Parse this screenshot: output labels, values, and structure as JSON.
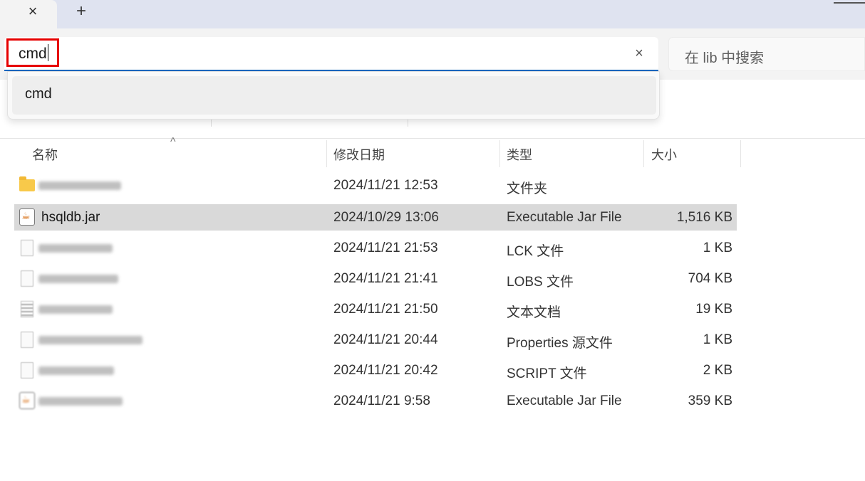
{
  "tabbar": {
    "close_glyph": "×",
    "new_tab_glyph": "+"
  },
  "address": {
    "value": "cmd",
    "clear_glyph": "×"
  },
  "search": {
    "placeholder": "在 lib 中搜索"
  },
  "suggestions": [
    {
      "label": "cmd"
    }
  ],
  "columns": {
    "name": "名称",
    "modified": "修改日期",
    "type": "类型",
    "size": "大小",
    "sort_glyph": "^"
  },
  "files": [
    {
      "icon": "folder-icon",
      "name": "",
      "name_blurred": true,
      "modified": "2024/11/21 12:53",
      "type": "文件夹",
      "size": ""
    },
    {
      "icon": "java-jar-icon",
      "name": "hsqldb.jar",
      "name_blurred": false,
      "modified": "2024/10/29 13:06",
      "type": "Executable Jar File",
      "size": "1,516 KB",
      "selected": true
    },
    {
      "icon": "file-icon",
      "name": "",
      "name_blurred": true,
      "modified": "2024/11/21 21:53",
      "type": "LCK 文件",
      "size": "1 KB"
    },
    {
      "icon": "file-icon",
      "name": "",
      "name_blurred": true,
      "modified": "2024/11/21 21:41",
      "type": "LOBS 文件",
      "size": "704 KB"
    },
    {
      "icon": "text-file-icon",
      "name": "",
      "name_blurred": true,
      "modified": "2024/11/21 21:50",
      "type": "文本文档",
      "size": "19 KB"
    },
    {
      "icon": "file-icon",
      "name": "",
      "name_blurred": true,
      "modified": "2024/11/21 20:44",
      "type": "Properties 源文件",
      "size": "1 KB"
    },
    {
      "icon": "file-icon",
      "name": "",
      "name_blurred": true,
      "modified": "2024/11/21 20:42",
      "type": "SCRIPT 文件",
      "size": "2 KB"
    },
    {
      "icon": "java-jar-icon",
      "name": "",
      "name_blurred": true,
      "modified": "2024/11/21 9:58",
      "type": "Executable Jar File",
      "size": "359 KB"
    }
  ],
  "colors": {
    "accent": "#0067c0",
    "highlight_box": "#e60000",
    "selected_row": "#d9d9d9"
  }
}
